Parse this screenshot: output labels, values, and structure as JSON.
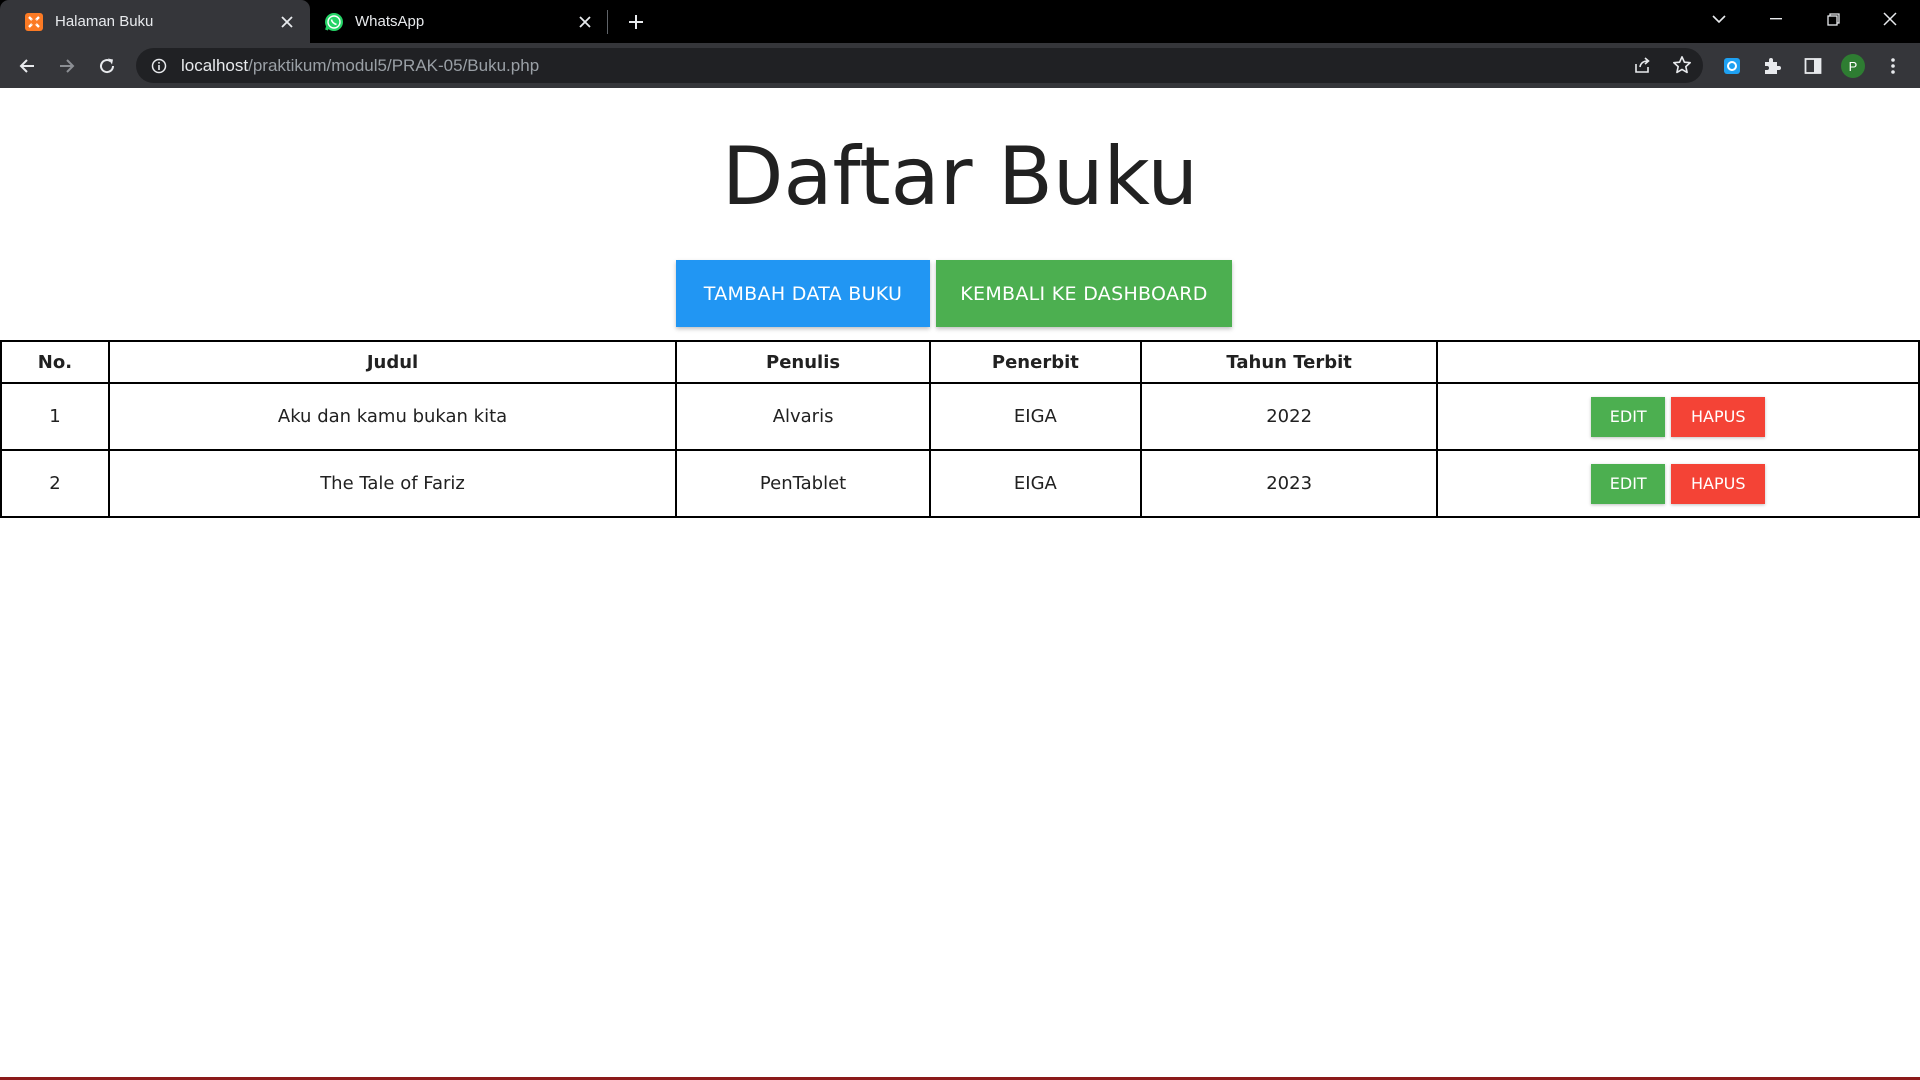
{
  "browser": {
    "tabs": [
      {
        "title": "Halaman Buku",
        "icon": "xampp-icon",
        "active": true
      },
      {
        "title": "WhatsApp",
        "icon": "whatsapp-icon",
        "active": false
      }
    ],
    "address": {
      "host": "localhost",
      "path": "/praktikum/modul5/PRAK-05/Buku.php"
    },
    "profile_initial": "P"
  },
  "page": {
    "title": "Daftar Buku",
    "buttons": {
      "add": "TAMBAH DATA BUKU",
      "back": "KEMBALI KE DASHBOARD"
    },
    "table": {
      "headers": [
        "No.",
        "Judul",
        "Penulis",
        "Penerbit",
        "Tahun Terbit",
        ""
      ],
      "rows": [
        {
          "no": "1",
          "judul": "Aku dan kamu bukan kita",
          "penulis": "Alvaris",
          "penerbit": "EIGA",
          "tahun": "2022",
          "edit": "EDIT",
          "hapus": "HAPUS"
        },
        {
          "no": "2",
          "judul": "The Tale of Fariz",
          "penulis": "PenTablet",
          "penerbit": "EIGA",
          "tahun": "2023",
          "edit": "EDIT",
          "hapus": "HAPUS"
        }
      ]
    }
  },
  "colors": {
    "primary_blue": "#2196f3",
    "success_green": "#4caf50",
    "danger_red": "#f44336"
  }
}
